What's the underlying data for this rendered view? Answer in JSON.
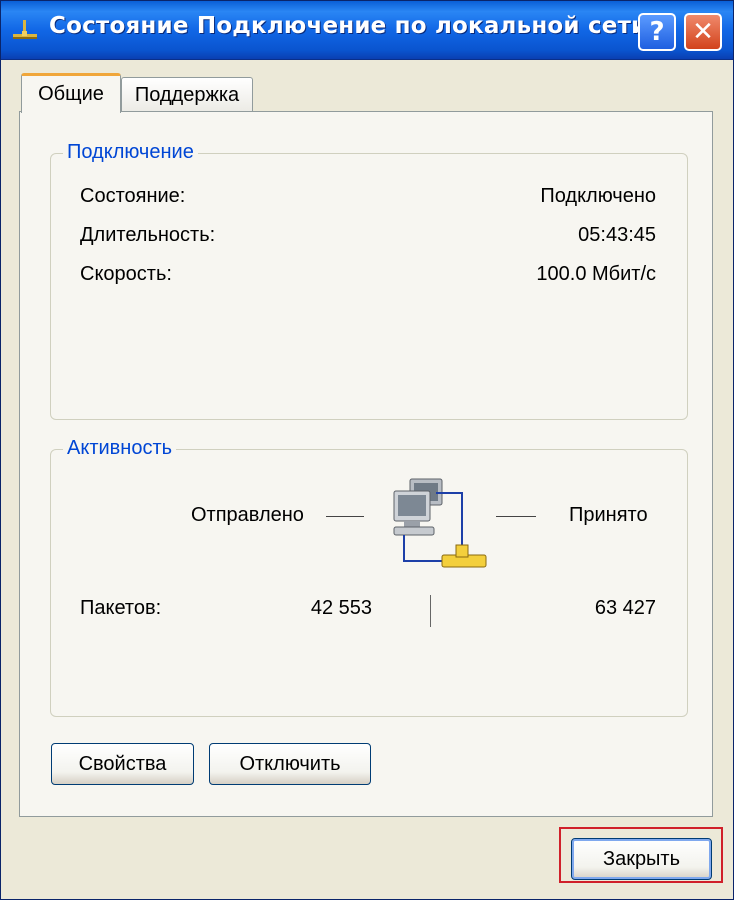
{
  "window": {
    "title": "Состояние Подключение по локальной сети",
    "help_label": "?",
    "close_label": "✕"
  },
  "tabs": [
    {
      "label": "Общие",
      "active": true
    },
    {
      "label": "Поддержка",
      "active": false
    }
  ],
  "connection": {
    "group_label": "Подключение",
    "rows": [
      {
        "label": "Состояние:",
        "value": "Подключено"
      },
      {
        "label": "Длительность:",
        "value": "05:43:45"
      },
      {
        "label": "Скорость:",
        "value": "100.0 Мбит/с"
      }
    ]
  },
  "activity": {
    "group_label": "Активность",
    "sent_label": "Отправлено",
    "received_label": "Принято",
    "packets_label": "Пакетов:",
    "packets_sent": "42 553",
    "packets_received": "63 427"
  },
  "buttons": {
    "properties": "Свойства",
    "disconnect": "Отключить",
    "close": "Закрыть"
  },
  "icons": {
    "title_icon": "network-connection-icon",
    "activity_icon": "network-computers-icon"
  },
  "colors": {
    "titlebar": "#0a54cf",
    "group_label": "#0046d5",
    "active_tab_accent": "#f0a63a",
    "focus_highlight": "#d0202a"
  }
}
